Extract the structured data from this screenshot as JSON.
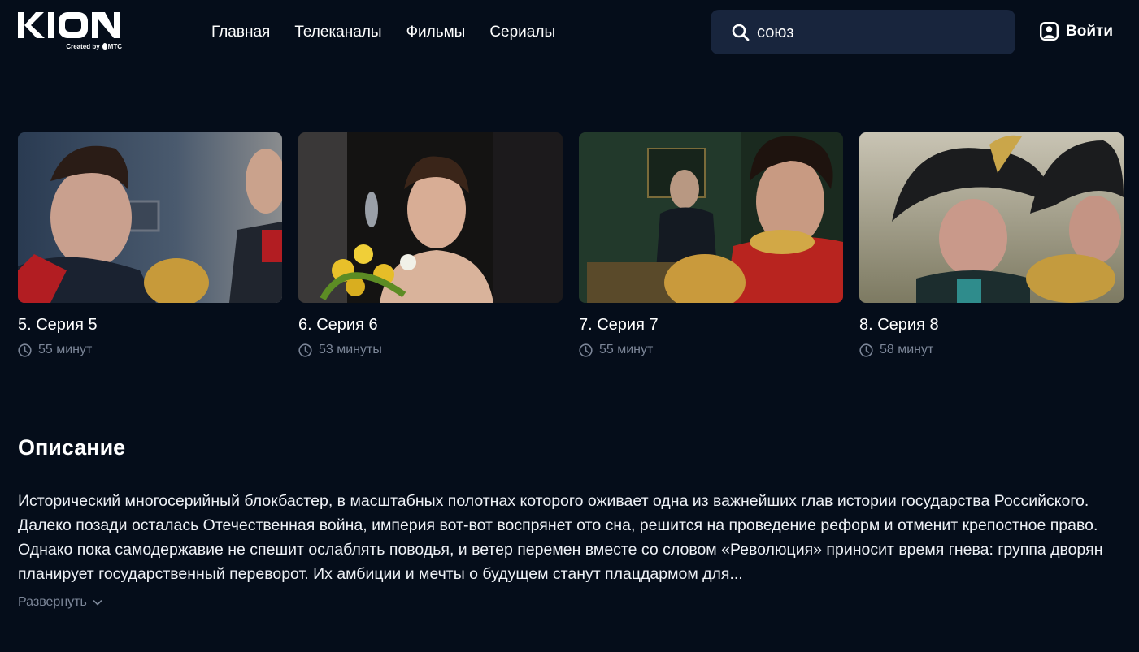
{
  "brand": {
    "name": "KION",
    "created_by": "Created by",
    "parent": "МТС"
  },
  "nav": [
    "Главная",
    "Телеканалы",
    "Фильмы",
    "Сериалы"
  ],
  "search": {
    "value": "союз",
    "icon": "search-icon"
  },
  "login": {
    "label": "Войти",
    "icon": "user-icon"
  },
  "episodes": [
    {
      "title": "5. Серия 5",
      "duration": "55 минут"
    },
    {
      "title": "6. Серия 6",
      "duration": "53 минуты"
    },
    {
      "title": "7. Серия 7",
      "duration": "55 минут"
    },
    {
      "title": "8. Серия 8",
      "duration": "58 минут"
    }
  ],
  "description": {
    "heading": "Описание",
    "text": "Исторический многосерийный блокбастер, в масштабных полотнах которого оживает одна из важнейших глав истории государства Российского. Далеко позади осталась Отечественная война, империя вот-вот воспрянет ото сна, решится на проведение реформ и отменит крепостное право. Однако пока самодержавие не спешит ослаблять поводья, и ветер перемен вместе со словом «Революция» приносит время гнева: группа дворян планирует государственный переворот. Их амбиции и мечты о будущем станут плацдармом для...",
    "expand": "Развернуть"
  },
  "colors": {
    "background": "#050d1a",
    "search_bg": "#18253d",
    "muted": "#7c8698"
  }
}
